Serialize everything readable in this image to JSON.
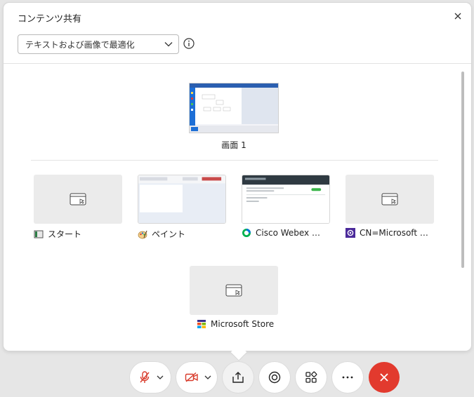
{
  "dialog": {
    "title": "コンテンツ共有",
    "optimize_select": "テキストおよび画像で最適化"
  },
  "screens": [
    {
      "label": "画面 1"
    }
  ],
  "apps": [
    {
      "label": "スタート",
      "icon": "start-icon"
    },
    {
      "label": "ペイント",
      "icon": "paint-icon"
    },
    {
      "label": "Cisco Webex Me...",
      "icon": "webex-icon"
    },
    {
      "label": "CN=Microsoft Wi...",
      "icon": "settings-app-icon"
    },
    {
      "label": "Microsoft Store",
      "icon": "store-icon"
    }
  ],
  "toolbar": {
    "buttons": [
      "mute-microphone",
      "stop-video",
      "share-content",
      "record",
      "apps",
      "more",
      "leave-meeting"
    ]
  },
  "colors": {
    "end_button": "#e23a2e",
    "mic_video_red": "#d83b2b"
  }
}
